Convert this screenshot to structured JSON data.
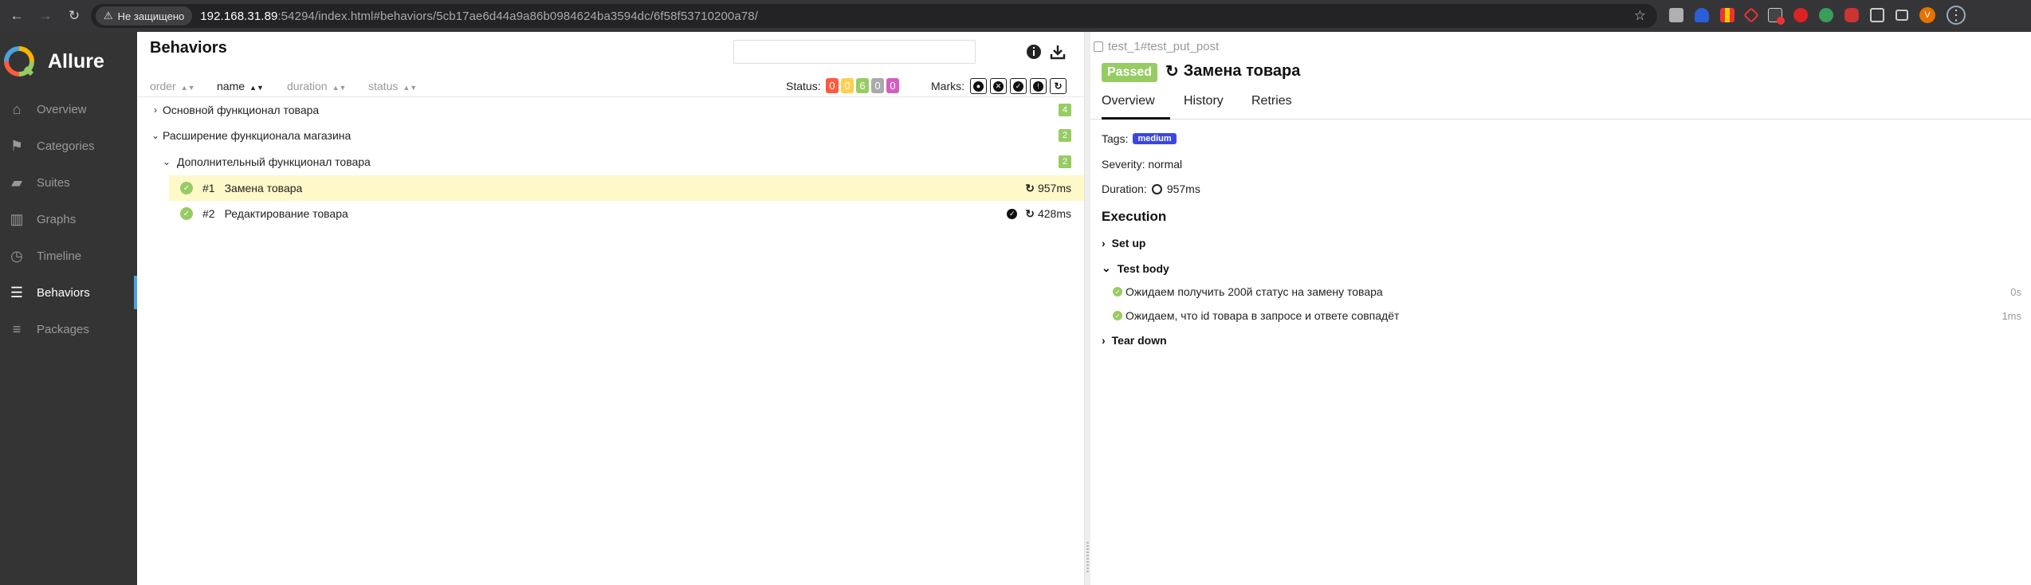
{
  "browser": {
    "security_label": "Не защищено",
    "url_host": "192.168.31.89",
    "url_rest": ":54294/index.html#behaviors/5cb17ae6d44a9a86b0984624ba3594dc/6f58f53710200a78/",
    "avatar_letter": "V"
  },
  "sidebar": {
    "brand": "Allure",
    "items": [
      {
        "label": "Overview",
        "icon": "home-icon"
      },
      {
        "label": "Categories",
        "icon": "flag-icon"
      },
      {
        "label": "Suites",
        "icon": "briefcase-icon"
      },
      {
        "label": "Graphs",
        "icon": "bar-chart-icon"
      },
      {
        "label": "Timeline",
        "icon": "clock-icon"
      },
      {
        "label": "Behaviors",
        "icon": "list-icon",
        "active": true
      },
      {
        "label": "Packages",
        "icon": "align-left-icon"
      }
    ]
  },
  "behaviors": {
    "title": "Behaviors",
    "sort": {
      "order": "order",
      "name": "name",
      "duration": "duration",
      "status": "status"
    },
    "status_label": "Status:",
    "status_counts": [
      {
        "value": "0",
        "color": "#fd5a3e"
      },
      {
        "value": "0",
        "color": "#ffd050"
      },
      {
        "value": "6",
        "color": "#97cc64"
      },
      {
        "value": "0",
        "color": "#aaaaaa"
      },
      {
        "value": "0",
        "color": "#d35ebe"
      }
    ],
    "marks_label": "Marks:",
    "tree": {
      "group1": {
        "name": "Основной функционал товара",
        "count": "4"
      },
      "group2": {
        "name": "Расширение функционала магазина",
        "count": "2"
      },
      "subgroup": {
        "name": "Дополнительный функционал товара",
        "count": "2"
      },
      "tests": [
        {
          "num": "#1",
          "name": "Замена товара",
          "duration": "957ms"
        },
        {
          "num": "#2",
          "name": "Редактирование товара",
          "duration": "428ms"
        }
      ]
    }
  },
  "test": {
    "crumb": "test_1#test_put_post",
    "status": "Passed",
    "title": "Замена товара",
    "tabs": {
      "overview": "Overview",
      "history": "History",
      "retries": "Retries"
    },
    "tags_label": "Tags:",
    "tag": "medium",
    "severity": "Severity: normal",
    "duration_label": "Duration:",
    "duration": "957ms",
    "execution": "Execution",
    "setup": "Set up",
    "body": "Test body",
    "teardown": "Tear down",
    "steps": [
      {
        "name": "Ожидаем получить 200й статус на замену товара",
        "time": "0s"
      },
      {
        "name": "Ожидаем, что id товара в запросе и ответе совпадёт",
        "time": "1ms"
      }
    ]
  }
}
